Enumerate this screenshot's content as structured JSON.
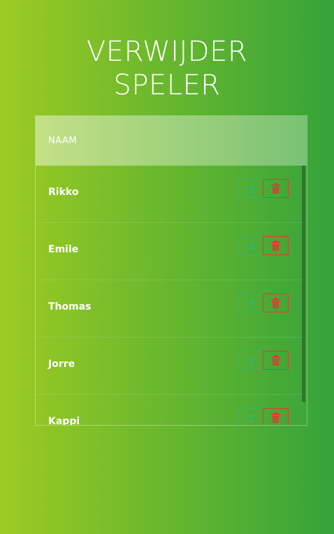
{
  "page": {
    "title_line1": "VERWIJDER",
    "title_line2": "SPELER"
  },
  "table": {
    "header": "NAAM",
    "rows": [
      {
        "name": "Rikko"
      },
      {
        "name": "Emile"
      },
      {
        "name": "Thomas"
      },
      {
        "name": "Jorre"
      },
      {
        "name": "Kappi"
      }
    ]
  },
  "icons": {
    "edit": "edit-icon",
    "delete": "trash-icon"
  },
  "colors": {
    "edit": "#2fb86f",
    "delete": "#e53935"
  }
}
